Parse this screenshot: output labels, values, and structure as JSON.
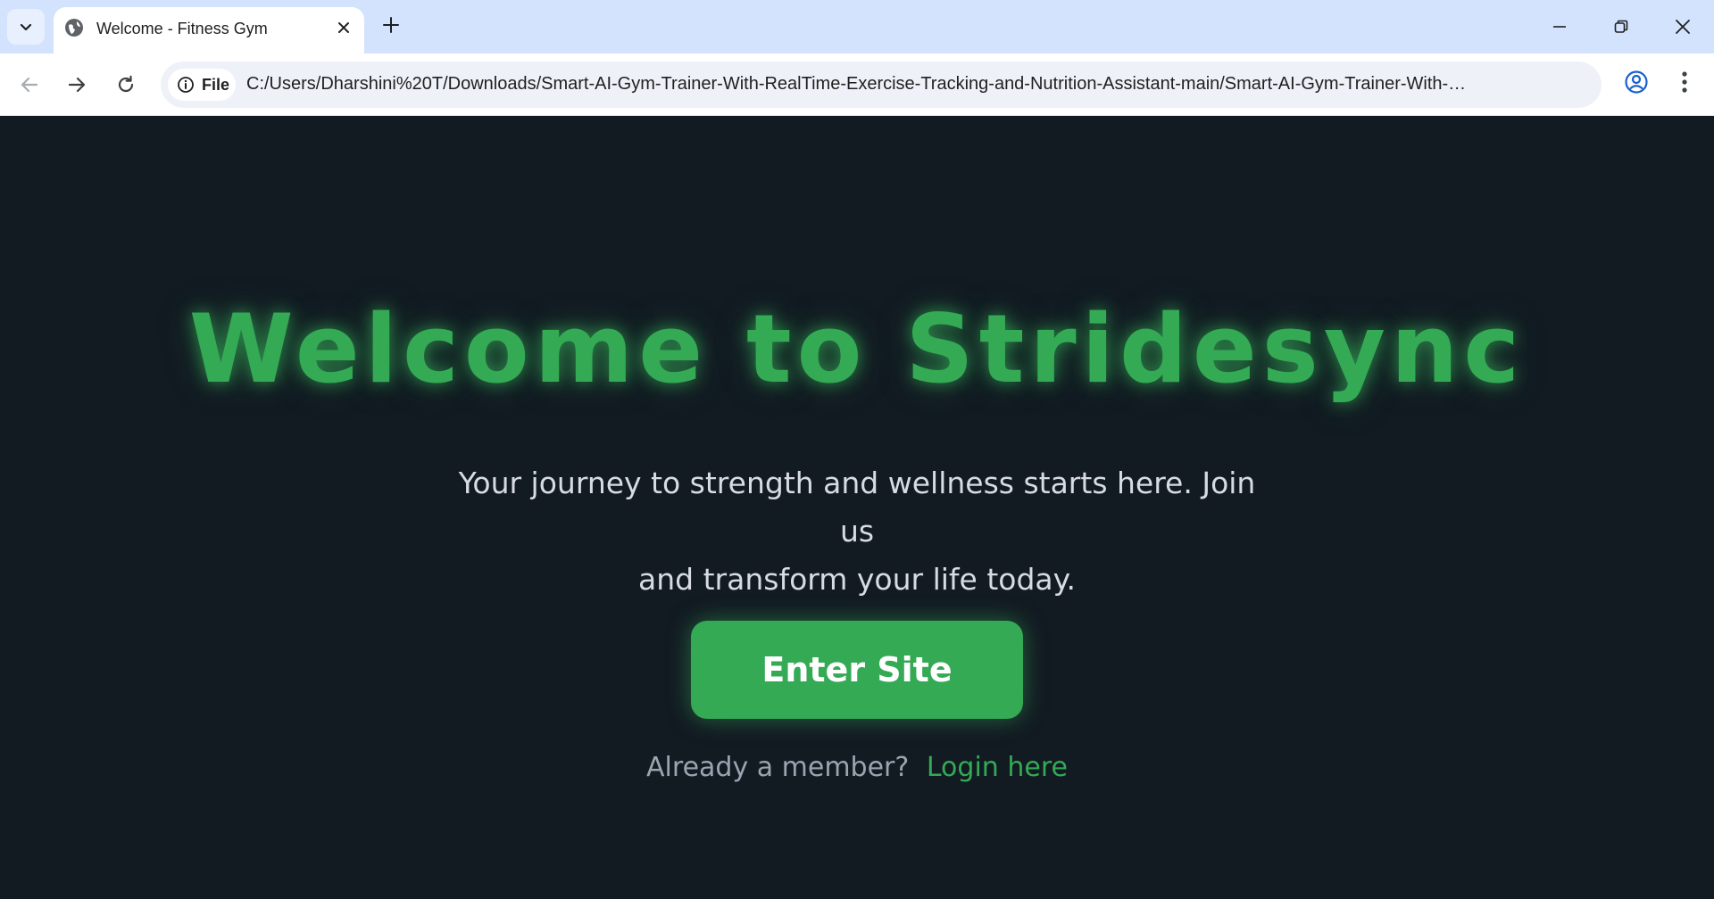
{
  "browser": {
    "tab_title": "Welcome - Fitness Gym",
    "chip_label": "File",
    "url": "C:/Users/Dharshini%20T/Downloads/Smart-AI-Gym-Trainer-With-RealTime-Exercise-Tracking-and-Nutrition-Assistant-main/Smart-AI-Gym-Trainer-With-Re..."
  },
  "page": {
    "title": "Welcome to Stridesync",
    "subtitle_line1": "Your journey to strength and wellness starts here. Join us",
    "subtitle_line2": "and transform your life today.",
    "enter_button": "Enter Site",
    "member_prompt": "Already a member?",
    "login_link": "Login here"
  },
  "colors": {
    "accent": "#34aa55",
    "page_background": "#121a22",
    "subtitle_text": "#d7dce2",
    "muted_text": "#9aa5b1",
    "tabstrip": "#d3e3fd"
  }
}
